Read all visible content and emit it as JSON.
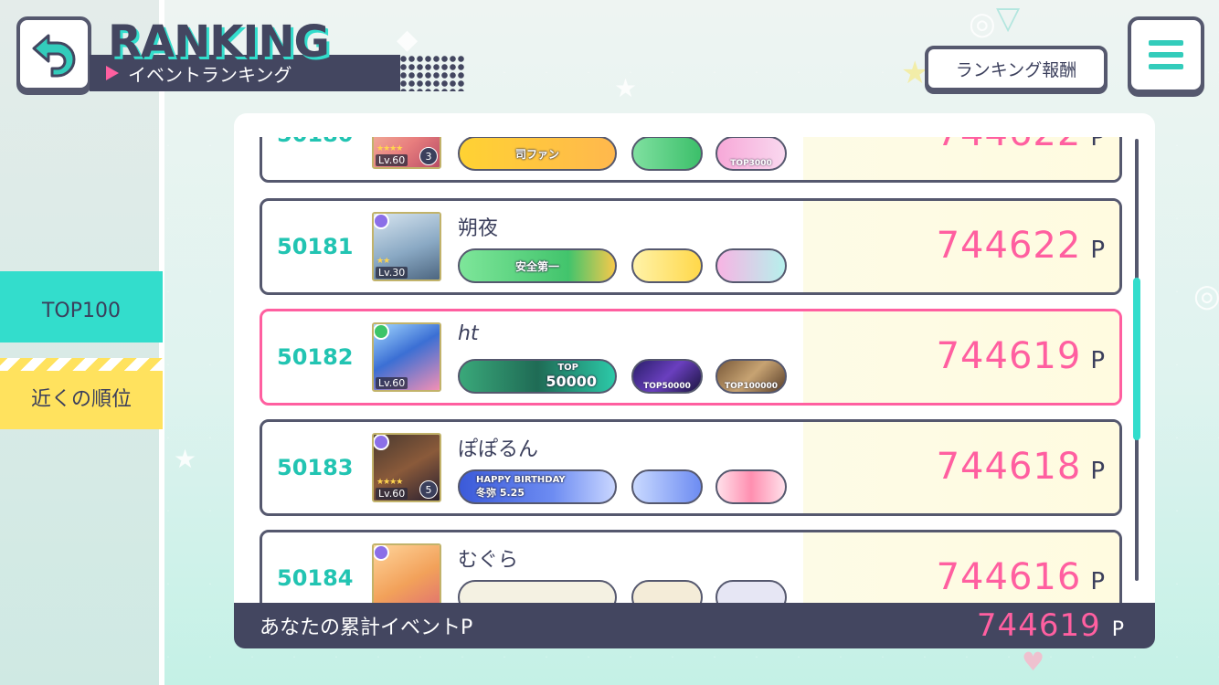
{
  "header": {
    "title": "RANKING",
    "subtitle": "イベントランキング",
    "reward_button": "ランキング報酬"
  },
  "sidebar": {
    "tabs": [
      {
        "label": "TOP100",
        "active": true
      },
      {
        "label": "近くの順位",
        "active": false
      }
    ]
  },
  "ranking": {
    "rows": [
      {
        "rank": "50180",
        "name": "",
        "level": "Lv.60",
        "master_rank": "3",
        "stars": "★★★★",
        "points": "744622",
        "unit": "P",
        "honors": {
          "main": "司ファン",
          "sub1": "",
          "sub2": "TOP3000"
        }
      },
      {
        "rank": "50181",
        "name": "朔夜",
        "level": "Lv.30",
        "master_rank": "",
        "stars": "★★",
        "points": "744622",
        "unit": "P",
        "honors": {
          "main": "安全第一",
          "sub1": "",
          "sub2": ""
        }
      },
      {
        "rank": "50182",
        "name": "ht",
        "level": "Lv.60",
        "master_rank": "",
        "stars": "",
        "points": "744619",
        "unit": "P",
        "is_self": true,
        "honors": {
          "main_top": "TOP",
          "main": "50000",
          "sub1": "TOP50000",
          "sub2": "TOP100000"
        }
      },
      {
        "rank": "50183",
        "name": "ぽぽるん",
        "level": "Lv.60",
        "master_rank": "5",
        "stars": "★★★★",
        "points": "744618",
        "unit": "P",
        "honors": {
          "main_line1": "HAPPY BIRTHDAY",
          "main_line2": "冬弥 5.25",
          "sub1": "",
          "sub2": ""
        }
      },
      {
        "rank": "50184",
        "name": "むぐら",
        "level": "",
        "master_rank": "",
        "stars": "",
        "points": "744616",
        "unit": "P",
        "honors": {
          "main": "",
          "sub1": "",
          "sub2": ""
        }
      }
    ]
  },
  "footer": {
    "label": "あなたの累計イベントP",
    "points": "744619",
    "unit": "P"
  },
  "colors": {
    "accent_teal": "#33ddcc",
    "accent_pink": "#ff5fa0",
    "navy": "#434660",
    "yellow": "#ffe25e"
  },
  "icons": {
    "back": "back-arrow-icon",
    "menu": "hamburger-menu-icon"
  }
}
